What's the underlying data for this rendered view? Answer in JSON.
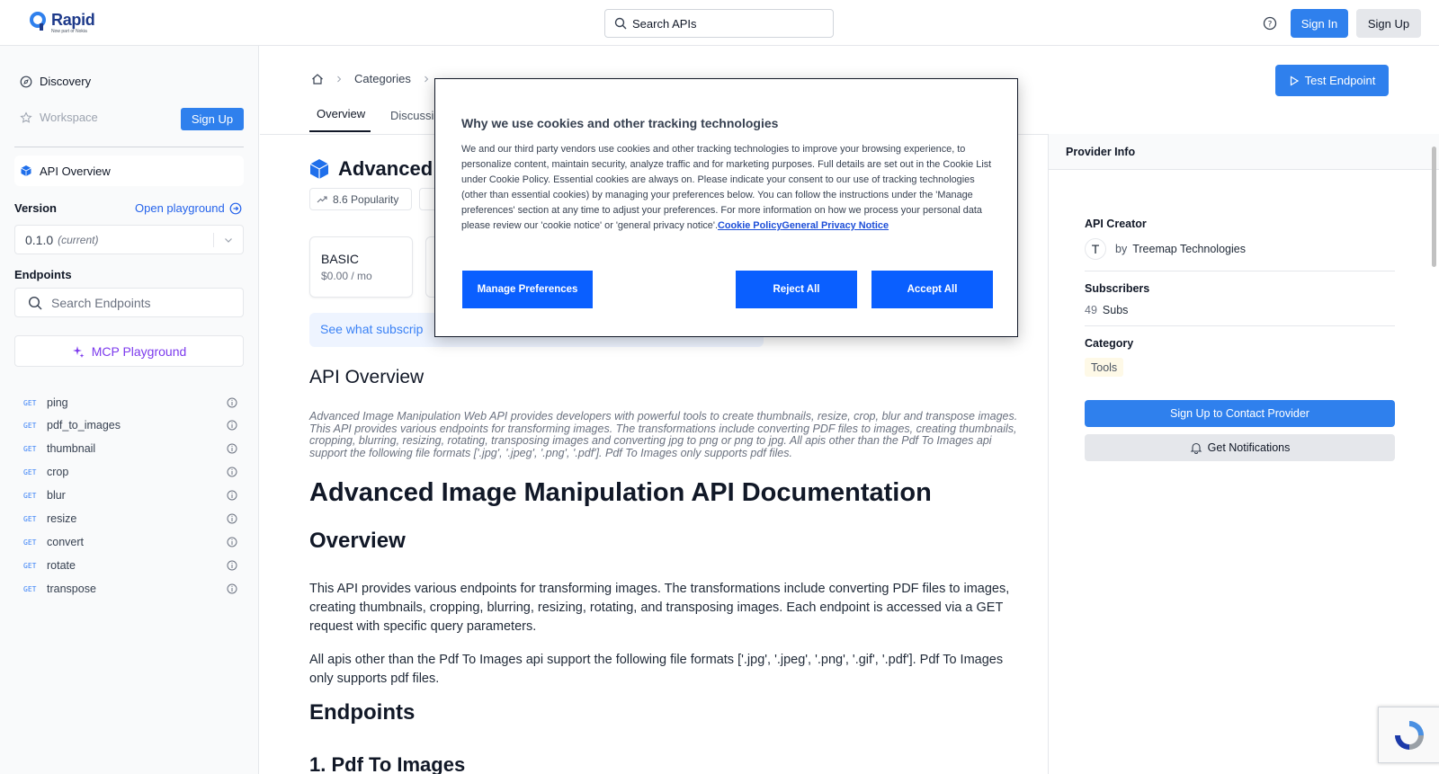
{
  "header": {
    "logo_name": "Rapid",
    "logo_sub": "Now part of Nokia",
    "search_placeholder": "Search APIs",
    "sign_in": "Sign In",
    "sign_up": "Sign Up",
    "brand_color": "#2f80ed"
  },
  "sidebar": {
    "discovery": "Discovery",
    "workspace": "Workspace",
    "sign_up": "Sign Up",
    "api_overview": "API Overview",
    "version_label": "Version",
    "open_playground": "Open playground",
    "version_value": "0.1.0",
    "version_note": "(current)",
    "endpoints_label": "Endpoints",
    "search_endpoints_placeholder": "Search Endpoints",
    "mcp_playground": "MCP Playground",
    "endpoints": [
      {
        "method": "GET",
        "name": "ping"
      },
      {
        "method": "GET",
        "name": "pdf_to_images"
      },
      {
        "method": "GET",
        "name": "thumbnail"
      },
      {
        "method": "GET",
        "name": "crop"
      },
      {
        "method": "GET",
        "name": "blur"
      },
      {
        "method": "GET",
        "name": "resize"
      },
      {
        "method": "GET",
        "name": "convert"
      },
      {
        "method": "GET",
        "name": "rotate"
      },
      {
        "method": "GET",
        "name": "transpose"
      }
    ]
  },
  "main": {
    "breadcrumb_categories": "Categories",
    "tabs": {
      "overview": "Overview",
      "discussions": "Discussi"
    },
    "test_endpoint": "Test Endpoint",
    "api_title": "Advanced",
    "popularity": "8.6 Popularity",
    "plan_name": "BASIC",
    "plan_price": "$0.00 / mo",
    "see_subscription": "See what subscrip",
    "overview_heading": "API Overview",
    "overview_desc": "Advanced Image Manipulation Web API provides developers with powerful tools to create thumbnails, resize, crop, blur and transpose images. This API provides various endpoints for transforming images. The transformations include converting PDF files to images, creating thumbnails, cropping, blurring, resizing, rotating, transposing images and converting jpg to png or png to jpg. All apis other than the Pdf To Images api support the following file formats ['.jpg', '.jpeg', '.png', '.pdf']. Pdf To Images only supports pdf files.",
    "doc_title": "Advanced Image Manipulation API Documentation",
    "overview_h2": "Overview",
    "para1": "This API provides various endpoints for transforming images. The transformations include converting PDF files to images, creating thumbnails, cropping, blurring, resizing, rotating, and transposing images. Each endpoint is accessed via a GET request with specific query parameters.",
    "para2": "All apis other than the Pdf To Images api support the following file formats ['.jpg', '.jpeg', '.png', '.gif', '.pdf']. Pdf To Images only supports pdf files.",
    "endpoints_h2": "Endpoints",
    "pdf_h3": "1. Pdf To Images"
  },
  "provider": {
    "heading": "Provider Info",
    "creator_label": "API Creator",
    "creator_initial": "T",
    "creator_by": "by",
    "creator_name": "Treemap Technologies",
    "subscribers_label": "Subscribers",
    "subscribers_count": "49",
    "subscribers_unit": "Subs",
    "category_label": "Category",
    "category_value": "Tools",
    "contact_button": "Sign Up to Contact Provider",
    "notify_button": "Get Notifications"
  },
  "cookie": {
    "title": "Why we use cookies and other tracking technologies",
    "body": "We and our third party vendors use cookies and other tracking technologies to improve your browsing experience, to personalize content, maintain security, analyze traffic and for marketing purposes. Full details are set out in the Cookie List under Cookie Policy. Essential cookies are always on. Please indicate your consent to our use of tracking technologies (other than essential cookies) by managing your preferences below. You can follow the instructions under the 'Manage preferences' section at any time to adjust your preferences. For more information on how we process your personal data please review our 'cookie notice' or 'general privacy notice'.",
    "link_cookie_policy": "Cookie Policy",
    "link_privacy": "General Privacy Notice",
    "manage": "Manage Preferences",
    "reject": "Reject All",
    "accept": "Accept All",
    "button_color": "#0a5fff"
  }
}
